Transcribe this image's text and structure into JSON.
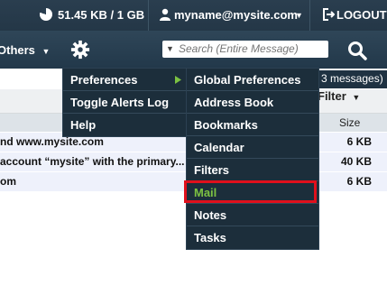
{
  "topbar": {
    "quota": "51.45 KB / 1 GB",
    "user": "myname@mysite.com",
    "logout": "LOGOUT"
  },
  "toolbar": {
    "others_label": "Others",
    "search_placeholder": "Search (Entire Message)"
  },
  "message_info": {
    "count_text": "3 messages)",
    "filter_label": "Filter",
    "size_header": "Size"
  },
  "messages": [
    {
      "subject": "nd www.mysite.com",
      "size": "6 KB"
    },
    {
      "subject": "account “mysite” with the primary...",
      "size": "40 KB"
    },
    {
      "subject": "om",
      "size": "6 KB"
    }
  ],
  "gear_menu": {
    "items": [
      "Preferences",
      "Toggle Alerts Log",
      "Help"
    ]
  },
  "preferences_menu": {
    "items": [
      "Global Preferences",
      "Address Book",
      "Bookmarks",
      "Calendar",
      "Filters",
      "Mail",
      "Notes",
      "Tasks"
    ],
    "highlighted": "Mail"
  },
  "colors": {
    "highlight_border": "#e0101c",
    "active_item_text": "#7cc242",
    "menu_bg": "#1c2e3b",
    "row_bg": "#eef1fb"
  },
  "icons": [
    "pie-chart-icon",
    "user-icon",
    "chevron-down-icon",
    "logout-icon",
    "gear-icon",
    "search-icon",
    "triangle-right-icon"
  ]
}
